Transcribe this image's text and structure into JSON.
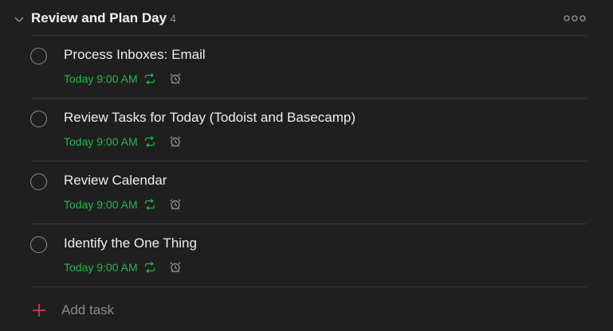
{
  "section": {
    "title": "Review and Plan Day",
    "count": "4",
    "toggle_icon": "chevron-down-icon",
    "more_icon": "more-horizontal-icon"
  },
  "tasks": [
    {
      "content": "Process Inboxes: Email",
      "due": "Today 9:00 AM",
      "recurring": true,
      "reminder": true
    },
    {
      "content": "Review Tasks for Today (Todoist and Basecamp)",
      "due": "Today 9:00 AM",
      "recurring": true,
      "reminder": true
    },
    {
      "content": "Review Calendar",
      "due": "Today 9:00 AM",
      "recurring": true,
      "reminder": true
    },
    {
      "content": "Identify the One Thing",
      "due": "Today 9:00 AM",
      "recurring": true,
      "reminder": true
    }
  ],
  "add_task": {
    "label": "Add task",
    "icon": "plus-icon"
  },
  "colors": {
    "background": "#1f1f1f",
    "text": "#eeeeee",
    "muted": "#8a8a8a",
    "due_green": "#25b84c",
    "accent_red": "#de4c4a",
    "divider": "#3a3a3a"
  }
}
